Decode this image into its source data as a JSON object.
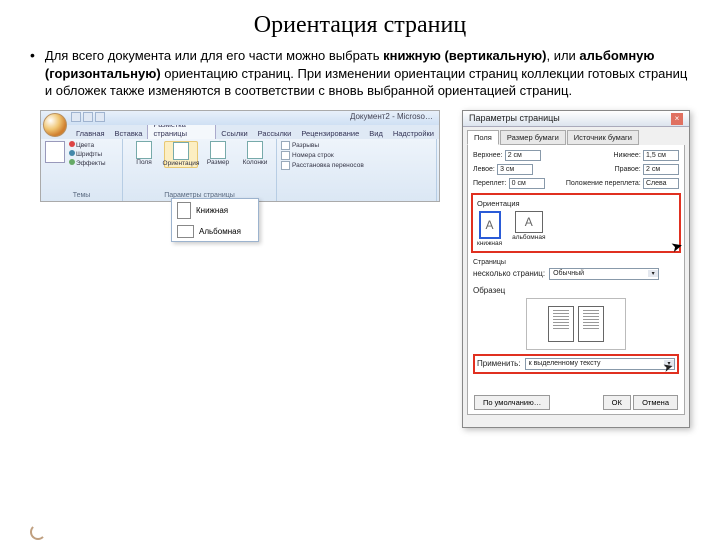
{
  "slide": {
    "title": "Ориентация страниц",
    "bullet_pre": "Для всего документа или для его части можно выбрать ",
    "bold1": "книжную (вертикальную)",
    "mid": ", или ",
    "bold2": "альбомную (горизонтальную)",
    "post": " ориентацию страниц. При изменении ориентации страниц коллекции готовых страниц и обложек также изменяются в соответствии с вновь выбранной ориентацией страниц."
  },
  "word": {
    "doc_title": "Документ2 - Microso…",
    "tabs": [
      "Главная",
      "Вставка",
      "Разметка страницы",
      "Ссылки",
      "Рассылки",
      "Рецензирование",
      "Вид",
      "Надстройки"
    ],
    "themes": {
      "group": "Темы",
      "colors": "Цвета",
      "fonts": "Шрифты",
      "effects": "Эффекты"
    },
    "page": {
      "margins": "Поля",
      "orient": "Ориентация",
      "size": "Размер",
      "cols": "Колонки",
      "group": "Параметры страницы"
    },
    "para": {
      "breaks": "Разрывы",
      "lines": "Номера строк",
      "hyphen": "Расстановка переносов"
    },
    "dropdown": {
      "portrait": "Книжная",
      "landscape": "Альбомная"
    }
  },
  "dialog": {
    "title": "Параметры страницы",
    "tabs": [
      "Поля",
      "Размер бумаги",
      "Источник бумаги"
    ],
    "margins": {
      "top": "Верхнее:",
      "top_v": "2 см",
      "bottom": "Нижнее:",
      "bottom_v": "1,5 см",
      "left": "Левое:",
      "left_v": "3 см",
      "right": "Правое:",
      "right_v": "2 см",
      "gutter": "Переплет:",
      "gutter_v": "0 см",
      "gpos": "Положение переплета:",
      "gpos_v": "Слева"
    },
    "orient": {
      "label": "Ориентация",
      "portrait": "книжная",
      "landscape": "альбомная"
    },
    "pages": {
      "label": "Страницы",
      "multi": "несколько страниц:",
      "val": "Обычный"
    },
    "preview": "Образец",
    "apply": {
      "label": "Применить:",
      "val": "к выделенному тексту"
    },
    "footer": {
      "default": "По умолчанию…",
      "ok": "ОК",
      "cancel": "Отмена"
    }
  }
}
